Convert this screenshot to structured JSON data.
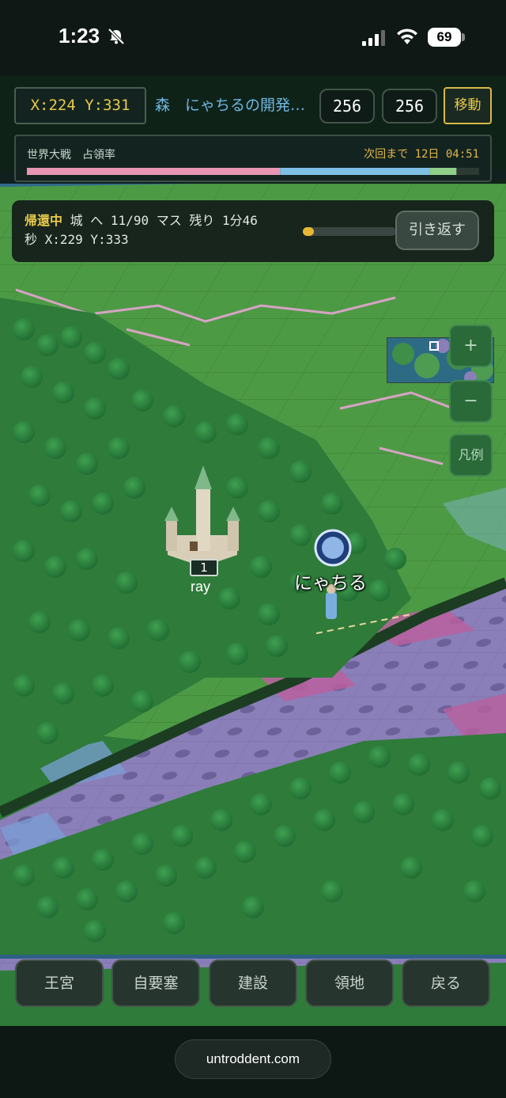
{
  "status_bar": {
    "time": "1:23",
    "battery": "69"
  },
  "header": {
    "coords": "X:224 Y:331",
    "tile_info": "森　にゃちるの開発…",
    "stat_a": "256",
    "stat_b": "256",
    "move_label": "移動"
  },
  "occupancy": {
    "label": "世界大戦　占領率",
    "timer": "次回まで 12日 04:51",
    "shares": [
      {
        "name": "pink",
        "fraction": 0.56,
        "color": "#e896b4"
      },
      {
        "name": "blue",
        "fraction": 0.33,
        "color": "#7fc0e6"
      },
      {
        "name": "green",
        "fraction": 0.06,
        "color": "#8fcf8a"
      },
      {
        "name": "rest",
        "fraction": 0.05,
        "color": "#2b3a33"
      }
    ]
  },
  "return_banner": {
    "status": "帰還中",
    "detail_line1": " 城 へ 11/90 マス 残り 1分46",
    "detail_line2": "秒 X:229 Y:333",
    "progress": 0.12,
    "button_label": "引き返す"
  },
  "map_controls": {
    "zoom_in": "+",
    "zoom_out": "−",
    "legend": "凡例"
  },
  "map_labels": {
    "castle_level": "1",
    "castle_owner": "ray",
    "player_name": "にゃちる"
  },
  "bottom_nav": [
    {
      "label": "王宮"
    },
    {
      "label": "自要塞"
    },
    {
      "label": "建設"
    },
    {
      "label": "領地"
    },
    {
      "label": "戻る"
    }
  ],
  "browser": {
    "url": "untroddent.com"
  },
  "colors": {
    "accent_yellow": "#e8c94a",
    "info_blue": "#6fb7e2",
    "grass": "#4d9a45",
    "forest": "#2f7b3a",
    "purple_territory": "#8a7fb8",
    "pink_territory": "#b8609e"
  }
}
